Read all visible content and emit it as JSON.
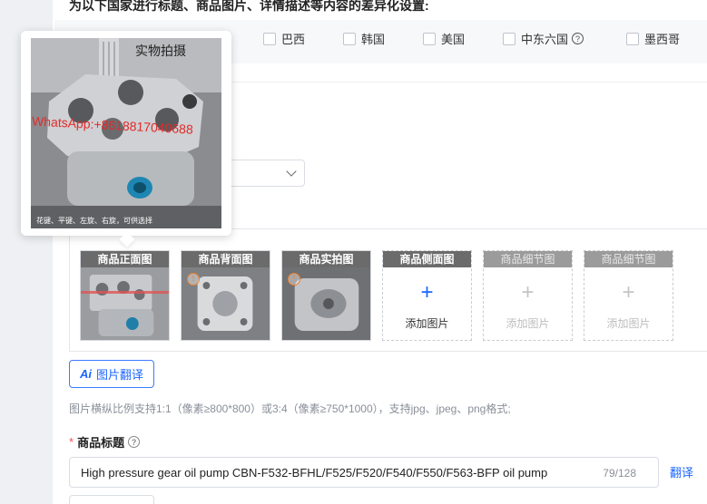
{
  "section": {
    "heading": "为以下国家进行标题、商品图片、详情描述等内容的差异化设置:"
  },
  "countries": [
    {
      "label": "巴西"
    },
    {
      "label": "韩国"
    },
    {
      "label": "美国"
    },
    {
      "label": "中东六国"
    },
    {
      "label": "墨西哥"
    }
  ],
  "popup": {
    "caption": "实物拍摄",
    "watermark": "WhatsApp:+8618817040688",
    "bottom_text": "花键、平键、左旋、右旋，可供选择"
  },
  "image_slots": [
    {
      "label": "商品正面图",
      "state": "filled"
    },
    {
      "label": "商品背面图",
      "state": "filled"
    },
    {
      "label": "商品实拍图",
      "state": "filled"
    },
    {
      "label": "商品侧面图",
      "state": "empty",
      "add_text": "添加图片"
    },
    {
      "label": "商品细节图",
      "state": "disabled",
      "add_text": "添加图片"
    },
    {
      "label": "商品细节图",
      "state": "disabled",
      "add_text": "添加图片"
    }
  ],
  "image_translate_button": {
    "icon_text": "Ai",
    "label": "图片翻译"
  },
  "image_hint": "图片横纵比例支持1:1（像素≥800*800）或3:4（像素≥750*1000），支持jpg、jpeg、png格式;",
  "product_title": {
    "required_mark": "*",
    "label": "商品标题",
    "value": "High pressure gear oil pump CBN-F532-BFHL/F525/F520/F540/F550/F563-BFP oil pump",
    "char_count": "79/128",
    "translate_link": "翻译"
  },
  "colors": {
    "accent": "#1a66ff",
    "warning": "#f07f2a",
    "watermark_red": "#e32b2b"
  }
}
